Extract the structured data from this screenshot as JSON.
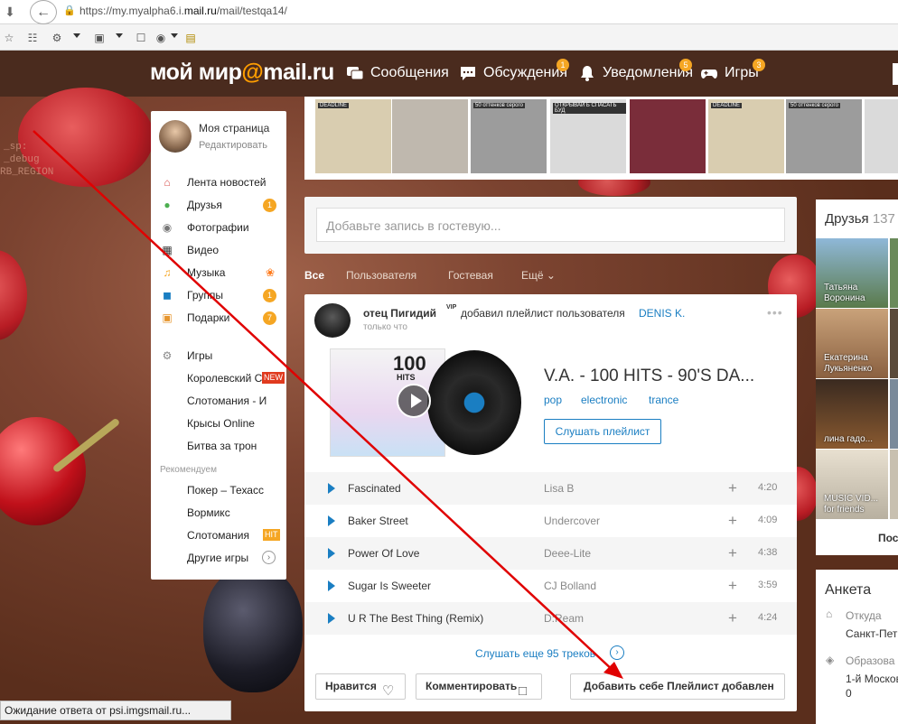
{
  "browser": {
    "url_prefix": "https://my.myalpha6.i.",
    "url_domain": "mail.ru",
    "url_path": "/mail/testqa14/",
    "status_text": "Ожидание ответа от psi.imgsmail.ru..."
  },
  "header": {
    "logo_text": "мой мир",
    "logo_at": "@",
    "logo_domain": "mail.ru",
    "nav": [
      {
        "label": "Сообщения",
        "icon": "messages-icon",
        "badge": ""
      },
      {
        "label": "Обсуждения",
        "icon": "discussions-icon",
        "badge": "1"
      },
      {
        "label": "Уведомления",
        "icon": "bell-icon",
        "badge": "5"
      },
      {
        "label": "Игры",
        "icon": "gamepad-icon",
        "badge": "3"
      }
    ]
  },
  "background_text": [
    "_sp:",
    "_debug",
    "RB_REGION"
  ],
  "profile": {
    "name": "Моя страница",
    "edit": "Редактировать"
  },
  "left_menu": [
    {
      "label": "Лента новостей",
      "icon": "home-icon",
      "badge": ""
    },
    {
      "label": "Друзья",
      "icon": "friends-icon",
      "badge": "1"
    },
    {
      "label": "Фотографии",
      "icon": "camera-icon",
      "badge": ""
    },
    {
      "label": "Видео",
      "icon": "film-icon",
      "badge": ""
    },
    {
      "label": "Музыка",
      "icon": "music-note-icon",
      "badge": ""
    },
    {
      "label": "Группы",
      "icon": "groups-icon",
      "badge": "1"
    },
    {
      "label": "Подарки",
      "icon": "gift-icon",
      "badge": "7"
    }
  ],
  "games_menu": {
    "header": "Игры",
    "items": [
      "Королевский С",
      "Слотомания - И",
      "Крысы Online",
      "Битва за трон"
    ],
    "new_tag": "NEW",
    "recommended_label": "Рекомендуем",
    "recommended": [
      "Покер – Техасс",
      "Вормикс",
      "Слотомания"
    ],
    "hit_tag": "HIT",
    "other_games": "Другие игры"
  },
  "ribbon_captions": [
    "DEADLINE",
    "50 оттенков серого",
    "ОТКРЫВАЙ Б СПАСАТЬ БУД",
    "DEADLINE",
    "50 оттенков серого"
  ],
  "guestbook": {
    "placeholder": "Добавьте запись в гостевую..."
  },
  "filters": [
    "Все",
    "Пользователя",
    "Гостевая",
    "Ещё"
  ],
  "post": {
    "author": "отец Пигидий",
    "vip": "VIP",
    "action": "добавил плейлист пользователя",
    "target_user": "DENIS K.",
    "time": "только что",
    "album_big": "100",
    "album_small": "HITS",
    "playlist_title": "V.A. - 100 HITS - 90'S DA...",
    "genres": [
      "pop",
      "electronic",
      "trance"
    ],
    "listen_button": "Слушать плейлист",
    "tracks": [
      {
        "title": "Fascinated",
        "artist": "Lisa B",
        "duration": "4:20"
      },
      {
        "title": "Baker Street",
        "artist": "Undercover",
        "duration": "4:09"
      },
      {
        "title": "Power Of Love",
        "artist": "Deee-Lite",
        "duration": "4:38"
      },
      {
        "title": "Sugar Is Sweeter",
        "artist": "CJ Bolland",
        "duration": "3:59"
      },
      {
        "title": "U R The Best Thing (Remix)",
        "artist": "D:Ream",
        "duration": "4:24"
      }
    ],
    "more_tracks": "Слушать еще 95 треков",
    "like_button": "Нравится",
    "comment_button": "Комментировать",
    "add_button": "Добавить себе Плейлист добавлен"
  },
  "friends": {
    "title": "Друзья",
    "count": "137",
    "list": [
      {
        "name": "Татьяна Воронина"
      },
      {
        "name": "Екатерина Лукьяненко"
      },
      {
        "name": "лина гадо..."
      },
      {
        "name": "MUSIC VID... for friends"
      }
    ],
    "more": "Пос"
  },
  "anketa": {
    "title": "Анкета",
    "from_label": "Откуда",
    "from_value": "Санкт-Пет",
    "edu_label": "Образова",
    "edu_value": "1-й Москов",
    "edu_value2": "0"
  },
  "colors": {
    "header_bg": "#4a2b1e",
    "accent_blue": "#1a7ec2",
    "badge_orange": "#f5a623",
    "annotation_red": "#e00000"
  }
}
